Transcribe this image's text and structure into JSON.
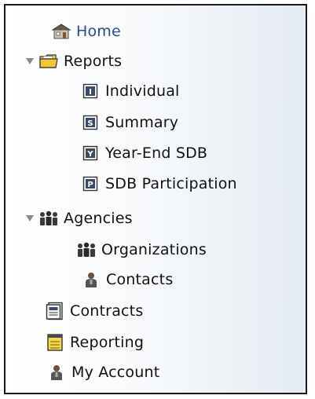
{
  "nav": {
    "home": "Home",
    "reports": {
      "label": "Reports",
      "children": [
        "Individual",
        "Summary",
        "Year-End SDB",
        "SDB Participation"
      ]
    },
    "agencies": {
      "label": "Agencies",
      "children": [
        "Organizations",
        "Contacts"
      ]
    },
    "contracts": "Contracts",
    "reporting": "Reporting",
    "my_account": "My Account"
  },
  "icons": {
    "home": "house-icon",
    "reports": "folder-icon",
    "individual": "report-i-icon",
    "summary": "report-s-icon",
    "year_end": "report-y-icon",
    "participation": "report-p-icon",
    "agencies": "people-group-icon",
    "organizations": "people-group-icon",
    "contacts": "person-icon",
    "contracts": "contract-icon",
    "reporting": "notepad-icon",
    "my_account": "person-icon"
  },
  "colors": {
    "home_text": "#2b4a8a",
    "panel_gradient_end": "#e4ebf3"
  }
}
